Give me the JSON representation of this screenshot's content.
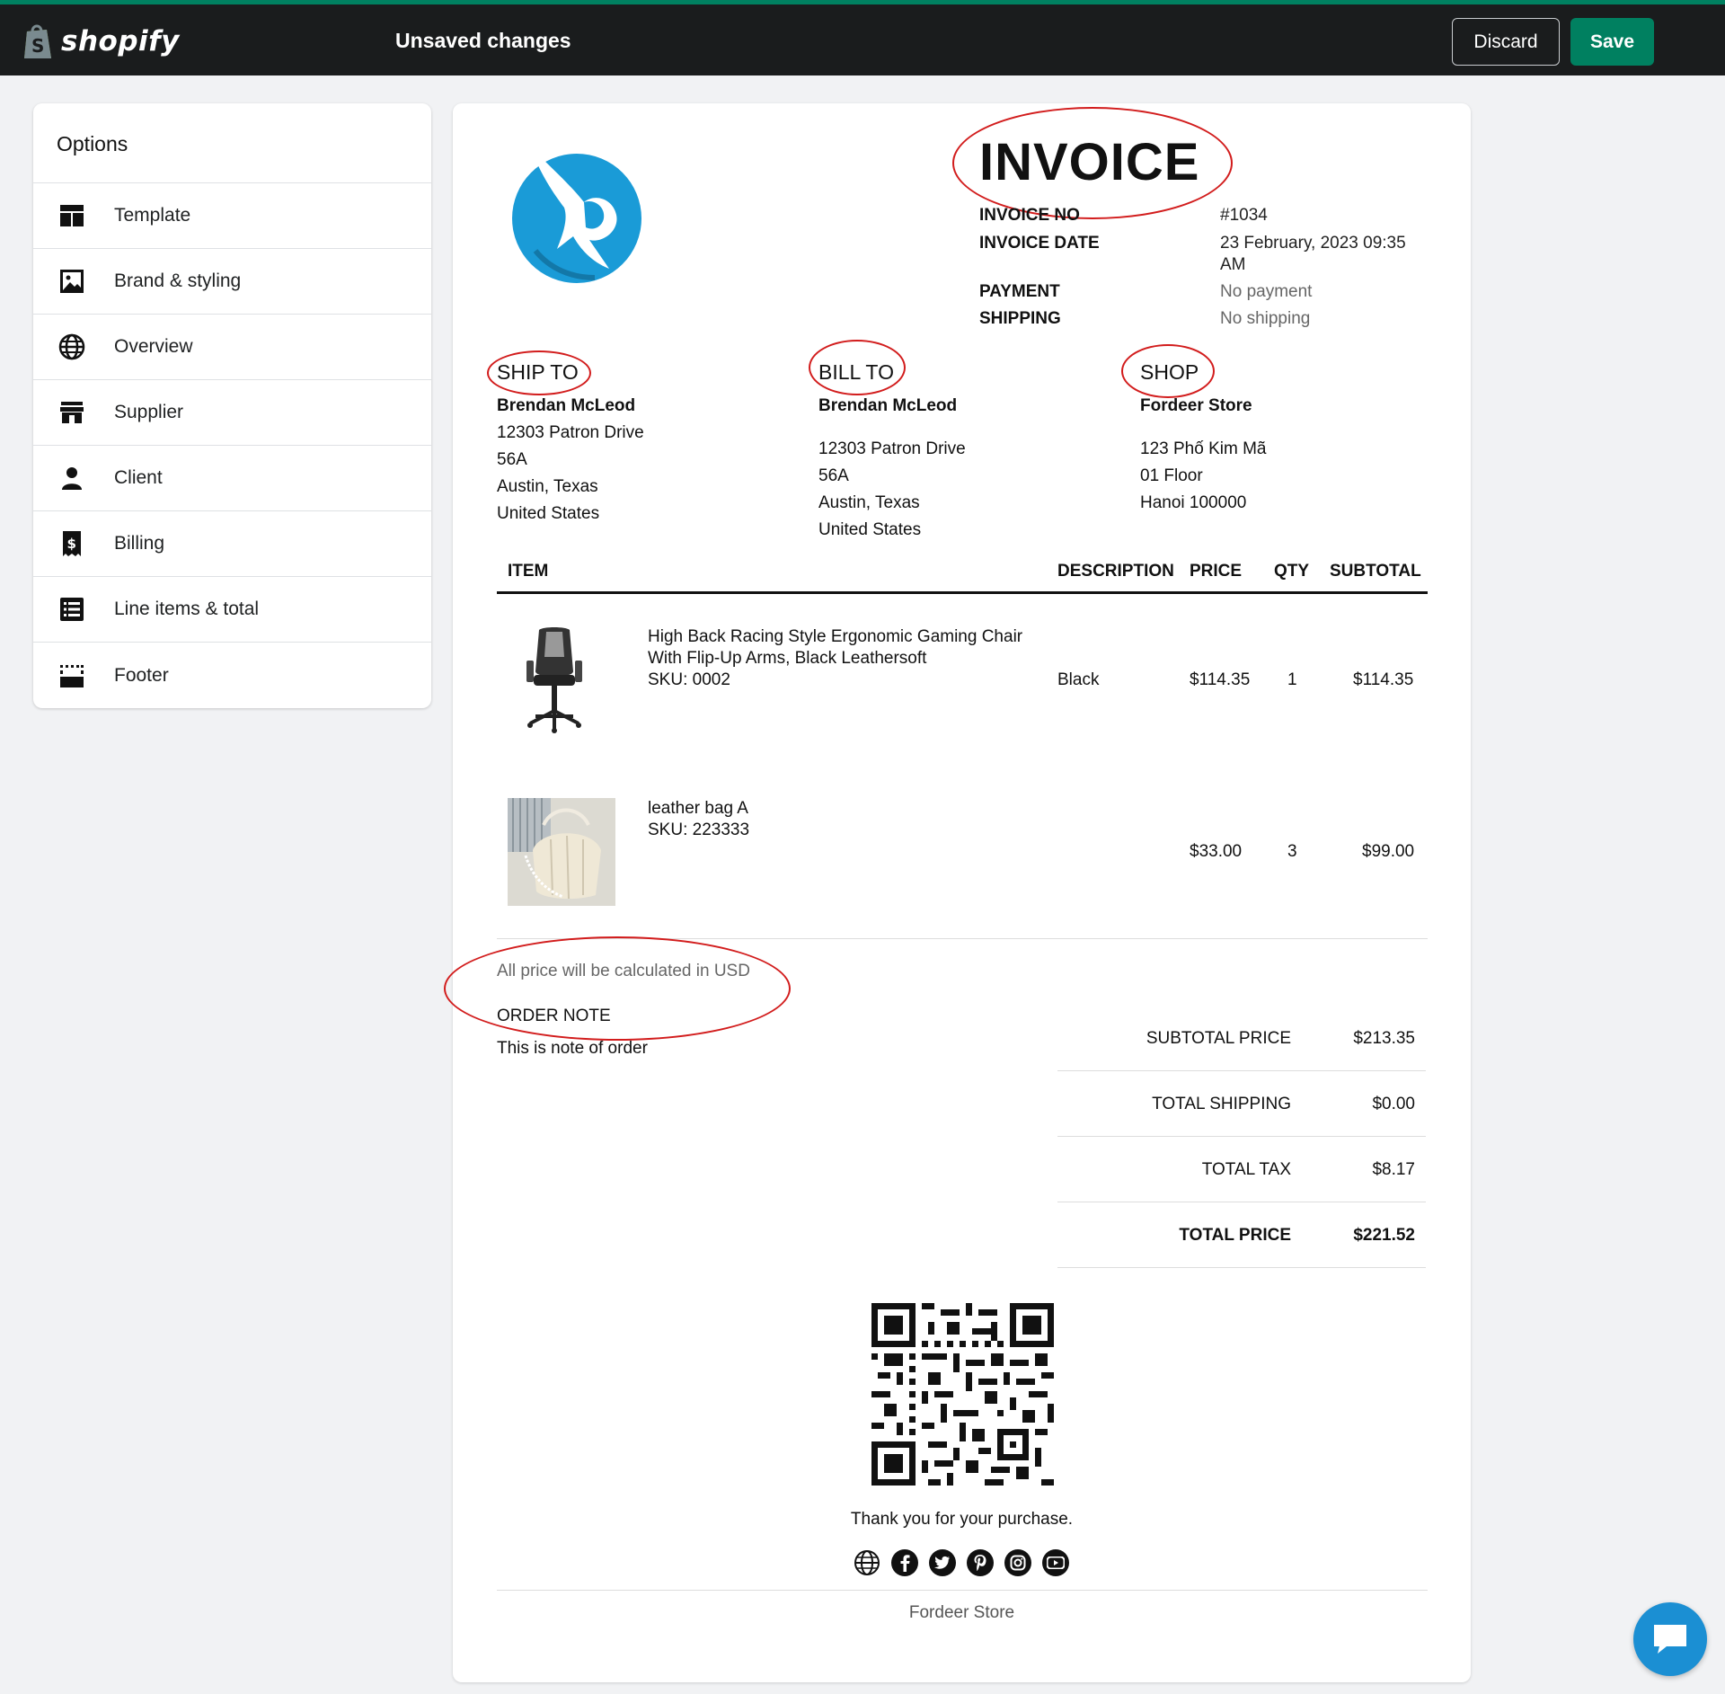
{
  "topbar": {
    "brand": "shopify",
    "status": "Unsaved changes",
    "discard_label": "Discard",
    "save_label": "Save",
    "accent": "#008060"
  },
  "options": {
    "title": "Options",
    "items": [
      {
        "label": "Template",
        "icon": "template-icon"
      },
      {
        "label": "Brand & styling",
        "icon": "image-icon"
      },
      {
        "label": "Overview",
        "icon": "globe-icon"
      },
      {
        "label": "Supplier",
        "icon": "store-icon"
      },
      {
        "label": "Client",
        "icon": "person-icon"
      },
      {
        "label": "Billing",
        "icon": "receipt-icon"
      },
      {
        "label": "Line items & total",
        "icon": "list-icon"
      },
      {
        "label": "Footer",
        "icon": "footer-icon"
      }
    ]
  },
  "invoice": {
    "title": "INVOICE",
    "meta": {
      "invoice_no_label": "INVOICE NO",
      "invoice_no": "#1034",
      "invoice_date_label": "INVOICE DATE",
      "invoice_date_line1": "23 February, 2023 09:35",
      "invoice_date_line2": "AM",
      "payment_label": "PAYMENT",
      "payment": "No payment",
      "shipping_label": "SHIPPING",
      "shipping": "No shipping"
    },
    "ship_to": {
      "heading": "SHIP TO",
      "name": "Brendan McLeod",
      "line1": "12303 Patron Drive",
      "line2": "56A",
      "line3": "Austin, Texas",
      "line4": "United States"
    },
    "bill_to": {
      "heading": "BILL TO",
      "name": "Brendan McLeod",
      "line1": "12303 Patron Drive",
      "line2": "56A",
      "line3": "Austin, Texas",
      "line4": "United States"
    },
    "shop": {
      "heading": "SHOP",
      "name": "Fordeer Store",
      "line1": "123 Phố Kim Mã",
      "line2": "01 Floor",
      "line3": "Hanoi 100000"
    },
    "columns": {
      "item": "ITEM",
      "description": "DESCRIPTION",
      "price": "PRICE",
      "qty": "QTY",
      "subtotal": "SUBTOTAL"
    },
    "line_items": [
      {
        "name_line1": "High Back Racing Style Ergonomic Gaming Chair",
        "name_line2": "With Flip-Up Arms, Black Leathersoft",
        "sku": "SKU: 0002",
        "description": "Black",
        "price": "$114.35",
        "qty": "1",
        "subtotal": "$114.35"
      },
      {
        "name_line1": "leather bag A",
        "sku": "SKU: 223333",
        "description": "",
        "price": "$33.00",
        "qty": "3",
        "subtotal": "$99.00"
      }
    ],
    "currency_note": "All price will be calculated in USD",
    "order_note_label": "ORDER NOTE",
    "order_note": "This is note of order",
    "totals": {
      "subtotal_label": "SUBTOTAL PRICE",
      "subtotal": "$213.35",
      "shipping_label": "TOTAL SHIPPING",
      "shipping": "$0.00",
      "tax_label": "TOTAL TAX",
      "tax": "$8.17",
      "total_label": "TOTAL PRICE",
      "total": "$221.52"
    },
    "thanks": "Thank you for your purchase.",
    "social_icons": [
      "globe-icon",
      "facebook-icon",
      "twitter-icon",
      "pinterest-icon",
      "instagram-icon",
      "youtube-icon"
    ],
    "footer_store": "Fordeer Store",
    "logo_color": "#1a9bd7",
    "annotation_color": "#d21c1c"
  }
}
